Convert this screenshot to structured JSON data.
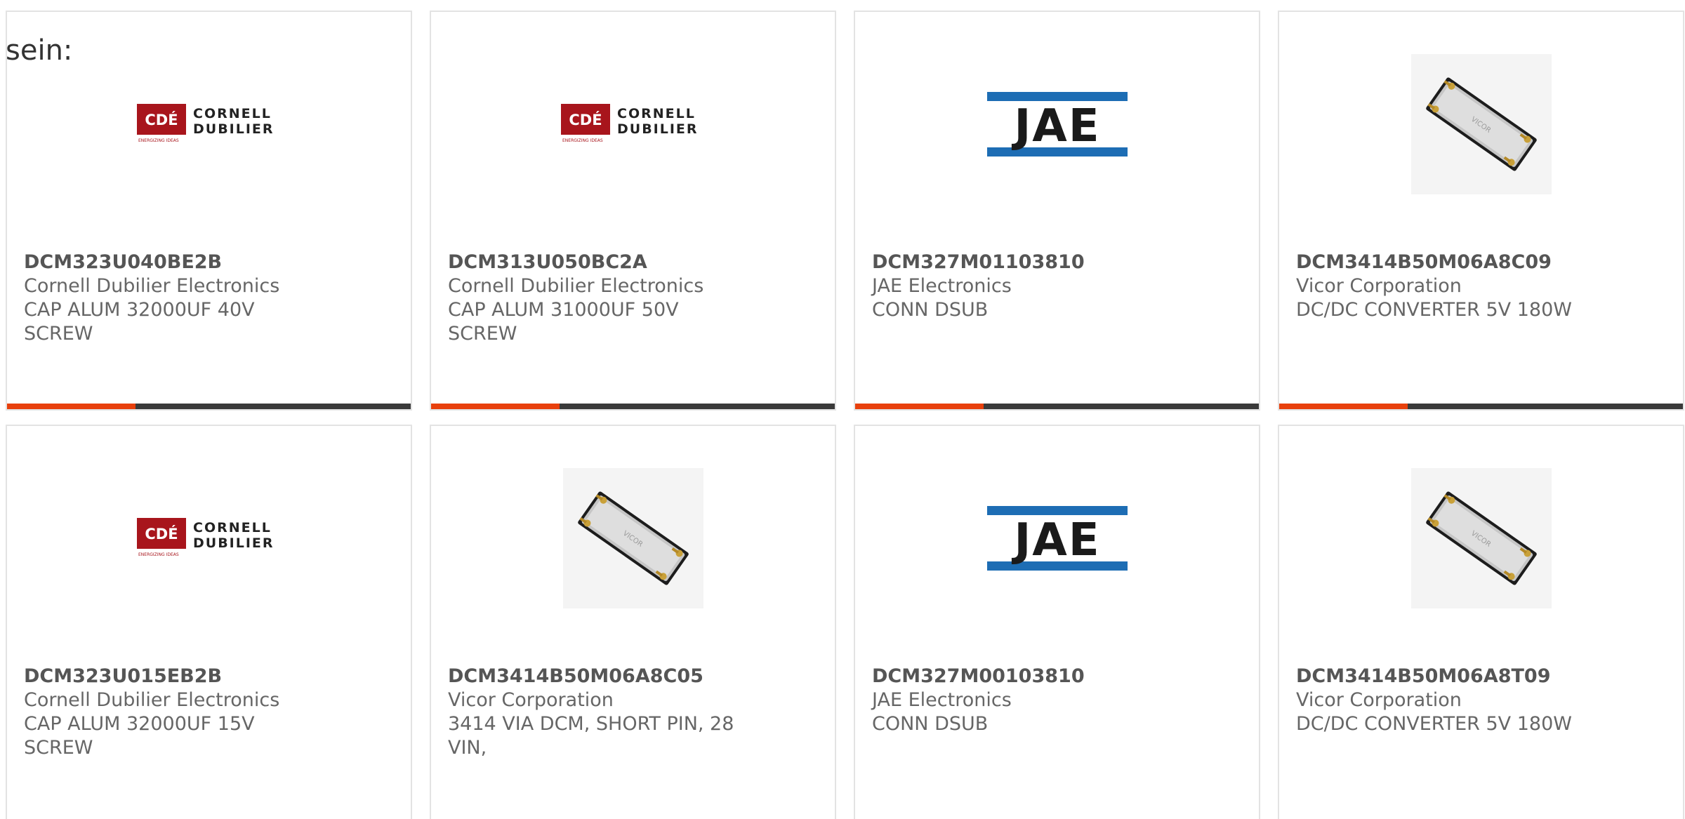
{
  "heading": "sein:",
  "colors": {
    "accent": "#e8400c",
    "bar": "#3a3a3a",
    "cde_red": "#a8151c",
    "jae_blue": "#1d6db4"
  },
  "products": [
    {
      "part": "DCM323U040BE2B",
      "manufacturer": "Cornell Dubilier Electronics",
      "description": "CAP ALUM 32000UF 40V SCREW",
      "image": "cornell-dubilier-logo",
      "logo_line1": "CORNELL",
      "logo_line2": "DUBILIER",
      "logo_badge": "CDÉ",
      "logo_tagline": "ENERGIZING IDEAS"
    },
    {
      "part": "DCM313U050BC2A",
      "manufacturer": "Cornell Dubilier Electronics",
      "description": "CAP ALUM 31000UF 50V SCREW",
      "image": "cornell-dubilier-logo",
      "logo_line1": "CORNELL",
      "logo_line2": "DUBILIER",
      "logo_badge": "CDÉ",
      "logo_tagline": "ENERGIZING IDEAS"
    },
    {
      "part": "DCM327M01103810",
      "manufacturer": "JAE Electronics",
      "description": "CONN DSUB",
      "image": "jae-logo",
      "logo_text": "JAE"
    },
    {
      "part": "DCM3414B50M06A8C09",
      "manufacturer": "Vicor Corporation",
      "description": "DC/DC CONVERTER 5V 180W",
      "image": "vicor-module-photo",
      "logo_text": "VICOR"
    },
    {
      "part": "DCM323U015EB2B",
      "manufacturer": "Cornell Dubilier Electronics",
      "description": "CAP ALUM 32000UF 15V SCREW",
      "image": "cornell-dubilier-logo",
      "logo_line1": "CORNELL",
      "logo_line2": "DUBILIER",
      "logo_badge": "CDÉ",
      "logo_tagline": "ENERGIZING IDEAS"
    },
    {
      "part": "DCM3414B50M06A8C05",
      "manufacturer": "Vicor Corporation",
      "description": "3414 VIA DCM, SHORT PIN, 28 VIN,",
      "image": "vicor-module-photo",
      "logo_text": "VICOR"
    },
    {
      "part": "DCM327M00103810",
      "manufacturer": "JAE Electronics",
      "description": "CONN DSUB",
      "image": "jae-logo",
      "logo_text": "JAE"
    },
    {
      "part": "DCM3414B50M06A8T09",
      "manufacturer": "Vicor Corporation",
      "description": "DC/DC CONVERTER 5V 180W",
      "image": "vicor-module-photo",
      "logo_text": "VICOR"
    }
  ]
}
